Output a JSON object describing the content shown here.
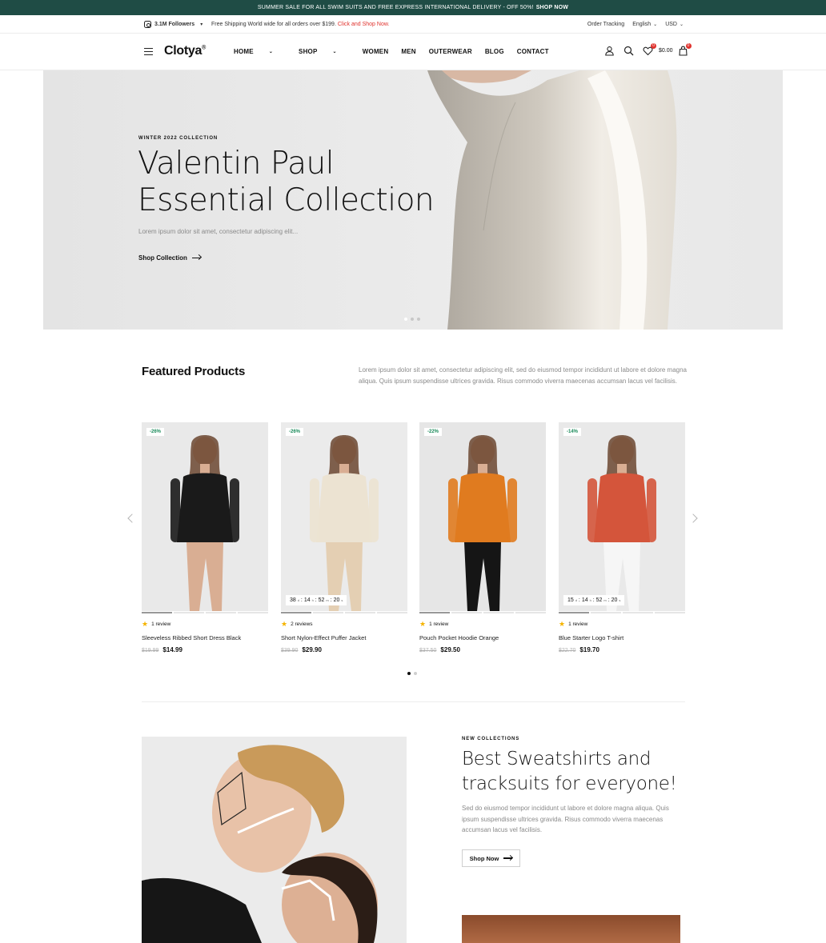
{
  "announcement": {
    "text": "SUMMER SALE FOR ALL SWIM SUITS AND FREE EXPRESS INTERNATIONAL DELIVERY - OFF 50%!",
    "link": "SHOP NOW"
  },
  "topbar": {
    "followers": "3.1M Followers",
    "shipping_text": "Free Shipping World wide for all orders over $199.",
    "shipping_link": "Click and Shop Now.",
    "order_tracking": "Order Tracking",
    "language": "English",
    "currency": "USD"
  },
  "header": {
    "logo": "Clotya",
    "logo_mark": "®",
    "nav": [
      "HOME",
      "SHOP",
      "WOMEN",
      "MEN",
      "OUTERWEAR",
      "BLOG",
      "CONTACT"
    ],
    "wishlist_count": "0",
    "cart_total": "$0.00",
    "cart_count": "0"
  },
  "hero": {
    "kicker": "WINTER 2022 COLLECTION",
    "title_line1": "Valentin Paul",
    "title_line2": "Essential Collection",
    "description": "Lorem ipsum dolor sit amet, consectetur adipiscing elit...",
    "cta": "Shop Collection"
  },
  "featured": {
    "title": "Featured Products",
    "description": "Lorem ipsum dolor sit amet, consectetur adipiscing elit, sed do eiusmod tempor incididunt ut labore et dolore magna aliqua. Quis ipsum suspendisse ultrices gravida. Risus commodo viverra maecenas accumsan lacus vel facilisis.",
    "products": [
      {
        "discount": "-26%",
        "reviews": "1 review",
        "name": "Sleeveless Ribbed Short Dress Black",
        "old_price": "$19.99",
        "price": "$14.99",
        "timer": null,
        "bg": "#e9e9e9",
        "garment": "#1a1a1a"
      },
      {
        "discount": "-26%",
        "reviews": "2 reviews",
        "name": "Short Nylon-Effect Puffer Jacket",
        "old_price": "$39.90",
        "price": "$29.90",
        "timer": {
          "d": "38",
          "h": "14",
          "m": "52",
          "s": "20"
        },
        "bg": "#ebebeb",
        "garment": "#ece3d2"
      },
      {
        "discount": "-22%",
        "reviews": "1 review",
        "name": "Pouch Pocket Hoodie Orange",
        "old_price": "$37.50",
        "price": "$29.50",
        "timer": null,
        "bg": "#e6e6e6",
        "garment": "#e07b1f"
      },
      {
        "discount": "-14%",
        "reviews": "1 review",
        "name": "Blue Starter Logo T-shirt",
        "old_price": "$22.70",
        "price": "$19.70",
        "timer": {
          "d": "15",
          "h": "14",
          "m": "52",
          "s": "20"
        },
        "bg": "#e9e9e9",
        "garment": "#d4553b"
      }
    ]
  },
  "collections": {
    "kicker": "NEW COLLECTIONS",
    "title": "Best Sweatshirts and tracksuits for everyone!",
    "description": "Sed do eiusmod tempor incididunt ut labore et dolore magna aliqua. Quis ipsum suspendisse ultrices gravida. Risus commodo viverra maecenas accumsan lacus vel facilisis.",
    "cta": "Shop Now"
  },
  "colors": {
    "announce_bg": "#1f4c45",
    "accent_red": "#e0322d",
    "discount_green": "#1a8a5a",
    "star": "#f5b301"
  }
}
